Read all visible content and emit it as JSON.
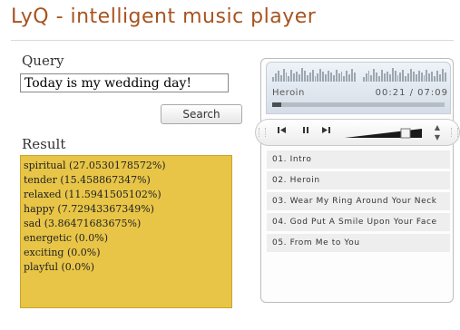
{
  "app": {
    "title": "LyQ - intelligent music player"
  },
  "query": {
    "label": "Query",
    "value": "Today is my wedding day!",
    "search_label": "Search"
  },
  "result": {
    "label": "Result",
    "lines": [
      "spiritual (27.0530178572%)",
      "tender (15.458867347%)",
      "relaxed (11.5941505102%)",
      "happy (7.72943367349%)",
      "sad (3.86471683675%)",
      "energetic (0.0%)",
      "exciting (0.0%)",
      "playful (0.0%)"
    ],
    "background_color": "#e8c547"
  },
  "player": {
    "track": "Heroin",
    "time": "00:21 / 07:09",
    "progress_fraction": 0.05,
    "volume_fraction": 0.85,
    "icons": {
      "prev": "skip-back-icon",
      "pause": "pause-icon",
      "next": "skip-forward-icon"
    },
    "playlist": [
      "01. Intro",
      "02. Heroin",
      "03. Wear My Ring Around Your Neck",
      "04. God Put A Smile Upon Your Face",
      "05. From Me to You"
    ]
  }
}
